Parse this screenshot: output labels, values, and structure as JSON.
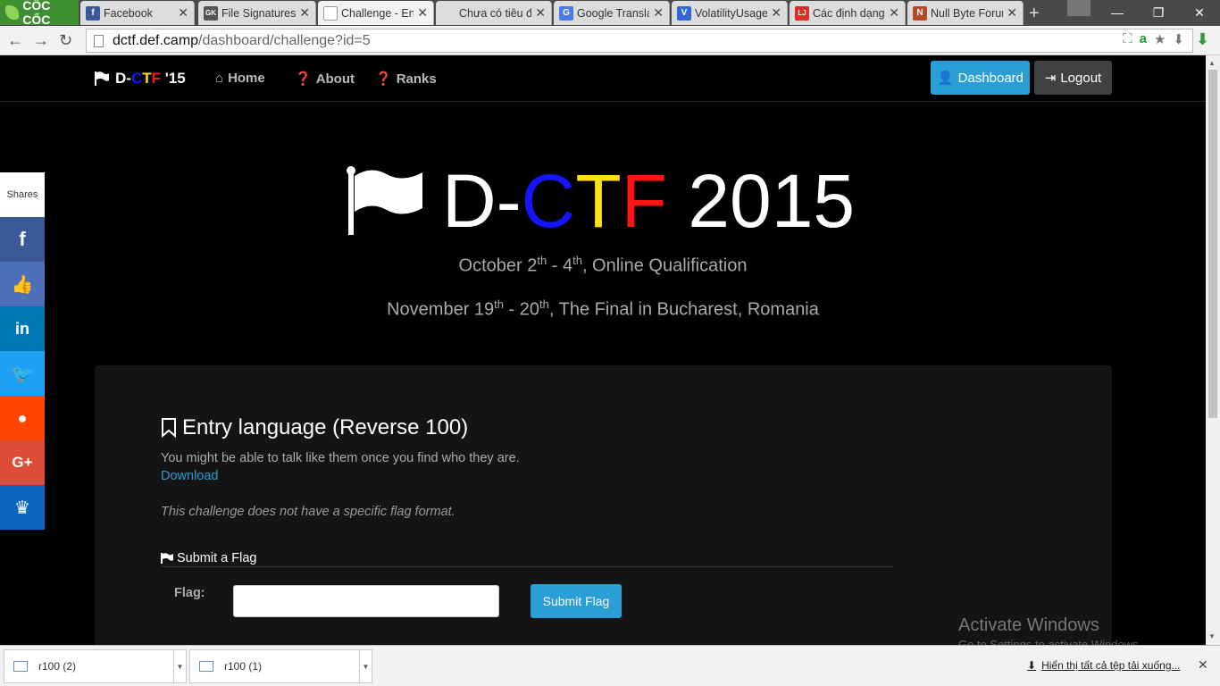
{
  "browser": {
    "logo_text": "CỐC CỐC",
    "tabs": [
      {
        "label": "Facebook",
        "color": "#3b5998",
        "glyph": "f"
      },
      {
        "label": "File Signatures",
        "color": "#555555",
        "glyph": "GK"
      },
      {
        "label": "Challenge - Ent",
        "color": "#ffffff",
        "glyph": ""
      },
      {
        "label": "Chưa có tiêu đề",
        "color": "#dcdcdc",
        "glyph": ""
      },
      {
        "label": "Google Translat",
        "color": "#4a7ae8",
        "glyph": "G"
      },
      {
        "label": "VolatilityUsage",
        "color": "#3367d6",
        "glyph": "V"
      },
      {
        "label": "Các định dạng",
        "color": "#d93025",
        "glyph": "LJ"
      },
      {
        "label": "Null Byte Forur",
        "color": "#b34a2a",
        "glyph": "N"
      }
    ],
    "url_host": "dctf.def.camp",
    "url_path": "/dashboard/challenge?id=5"
  },
  "nav": {
    "brand_prefix": "D-",
    "brand_c": "C",
    "brand_t": "T",
    "brand_f": "F",
    "brand_suffix": " '15",
    "home": "Home",
    "about": "About",
    "ranks": "Ranks",
    "dashboard": "Dashboard",
    "logout": "Logout"
  },
  "hero": {
    "d": "D-",
    "c": "C",
    "t": "T",
    "f": "F",
    "year": " 2015",
    "qual_a": "October 2",
    "qual_sup1": "th",
    "qual_b": " - 4",
    "qual_sup2": "th",
    "qual_c": ", Online Qualification",
    "final_a": "November 19",
    "final_sup1": "th",
    "final_b": " - 20",
    "final_sup2": "th",
    "final_c": ", The Final in Bucharest, Romania"
  },
  "challenge": {
    "title": "Entry language (Reverse 100)",
    "description": "You might be able to talk like them once you find who they are.",
    "download": "Download",
    "note": "This challenge does not have a specific flag format.",
    "submit_legend": "Submit a Flag",
    "flag_label": "Flag:",
    "flag_value": "",
    "submit_button": "Submit Flag"
  },
  "share": {
    "label": "Shares",
    "buttons": [
      {
        "name": "facebook",
        "color": "#3b5998",
        "glyph": "f"
      },
      {
        "name": "like",
        "color": "#4c70ba",
        "glyph": "👍"
      },
      {
        "name": "linkedin",
        "color": "#0077b5",
        "glyph": "in"
      },
      {
        "name": "twitter",
        "color": "#1da1f2",
        "glyph": "🐦"
      },
      {
        "name": "reddit",
        "color": "#ff4500",
        "glyph": "●"
      },
      {
        "name": "google-plus",
        "color": "#dd4b39",
        "glyph": "G+"
      },
      {
        "name": "sumo",
        "color": "#0b66c2",
        "glyph": "♛"
      }
    ]
  },
  "watermark": {
    "line1": "Activate Windows",
    "line2": "Go to Settings to activate Windows."
  },
  "downloads": {
    "items": [
      "r100 (2)",
      "r100 (1)"
    ],
    "show_all": "Hiển thị tất cả tệp tải xuống..."
  }
}
